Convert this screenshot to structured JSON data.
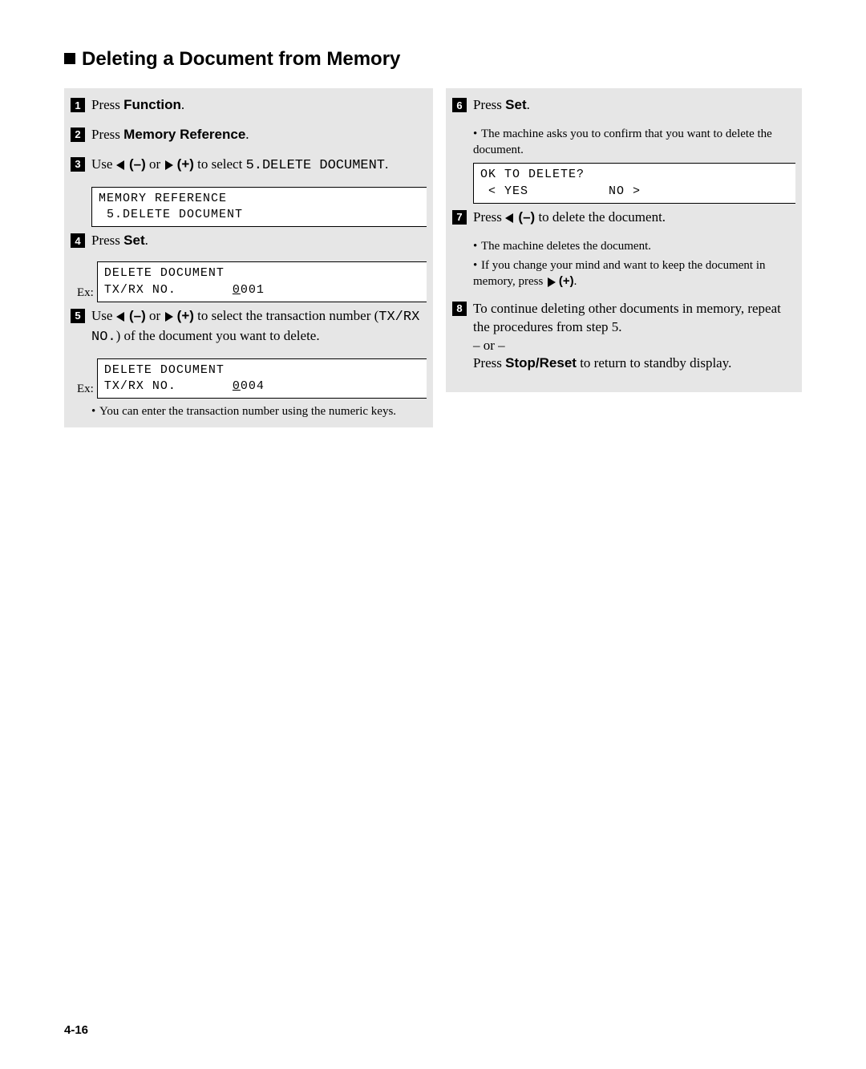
{
  "heading": "Deleting a Document from Memory",
  "left": {
    "step1": {
      "num": "1",
      "text_a": "Press ",
      "bold": "Function",
      "text_b": "."
    },
    "step2": {
      "num": "2",
      "text_a": "Press ",
      "bold": "Memory Reference",
      "text_b": "."
    },
    "step3": {
      "num": "3",
      "text_a": "Use ",
      "minus": "(–)",
      "text_b": " or ",
      "plus": "(+)",
      "text_c": " to select ",
      "mono": "5.DELETE DOCUMENT",
      "text_d": "."
    },
    "display3": "MEMORY REFERENCE\n 5.DELETE DOCUMENT",
    "step4": {
      "num": "4",
      "text_a": "Press ",
      "bold": "Set",
      "text_b": "."
    },
    "ex4": "Ex:",
    "display4": "DELETE DOCUMENT\nTX/RX NO.       0001",
    "step5": {
      "num": "5",
      "text_a": "Use ",
      "minus": "(–)",
      "text_b": " or ",
      "plus": "(+)",
      "text_c": " to select the transaction number (",
      "mono": "TX/RX NO.",
      "text_d": ") of the document you want to delete."
    },
    "ex5": "Ex:",
    "display5": "DELETE DOCUMENT\nTX/RX NO.       0004",
    "bullet5": "You can enter the transaction number using the numeric keys."
  },
  "right": {
    "step6": {
      "num": "6",
      "text_a": "Press ",
      "bold": "Set",
      "text_b": "."
    },
    "bullet6": "The machine asks you to confirm that you want to delete the document.",
    "display6": "OK TO DELETE?\n < YES          NO >",
    "step7": {
      "num": "7",
      "text_a": "Press ",
      "minus": "(–)",
      "text_b": " to delete the document."
    },
    "bullet7a": "The machine deletes the document.",
    "bullet7b_a": "If you change your mind and want to keep the document in memory, press ",
    "bullet7b_plus": "(+)",
    "bullet7b_b": ".",
    "step8": {
      "num": "8",
      "text_a": "To continue deleting other documents in memory, repeat the procedures from step 5.",
      "or": "– or –",
      "text_b": "Press ",
      "bold": "Stop/Reset",
      "text_c": " to return to standby display."
    }
  },
  "page_num": "4-16"
}
